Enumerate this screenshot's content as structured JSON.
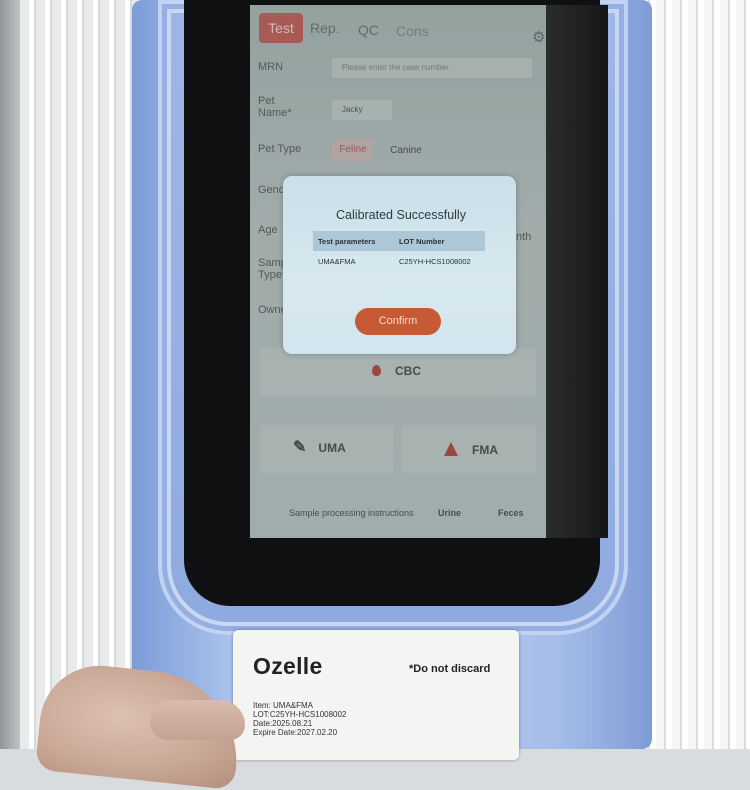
{
  "app": {
    "tabs": [
      "Test",
      "Rep.",
      "QC",
      "Cons"
    ],
    "active_tab": "Test",
    "settings_icon": "gear-icon"
  },
  "form": {
    "mrn_label": "MRN",
    "mrn_placeholder": "Please enter the case number",
    "pet_name_label": "Pet Name*",
    "pet_name_value": "Jacky",
    "pet_type_label": "Pet Type",
    "pet_type_options": [
      "Feline",
      "Canine"
    ],
    "pet_type_selected": "Feline",
    "gender_label": "Gende",
    "age_label": "Age",
    "age_unit_partial": "nth",
    "sample_type_label": "Samp Type*",
    "owner_label": "Owne"
  },
  "tests": {
    "cbc": "CBC",
    "uma": "UMA",
    "fma": "FMA"
  },
  "footer": {
    "instructions": "Sample processing instructions",
    "urine": "Urine",
    "feces": "Feces"
  },
  "modal": {
    "title": "Calibrated Successfully",
    "col_param": "Test parameters",
    "col_lot": "LOT Number",
    "row_param": "UMA&FMA",
    "row_lot": "C25YH-HCS1008002",
    "confirm": "Confirm"
  },
  "card": {
    "brand": "Ozelle",
    "notice": "*Do not discard",
    "item": "Item: UMA&FMA",
    "lot": "LOT:C25YH-HCS1008002",
    "date": "Date:2025.08.21",
    "expire": "Expire Date:2027.02.20"
  },
  "colors": {
    "accent": "#b3524d",
    "confirm": "#c65a34",
    "device_blue": "#a8c0ea"
  }
}
